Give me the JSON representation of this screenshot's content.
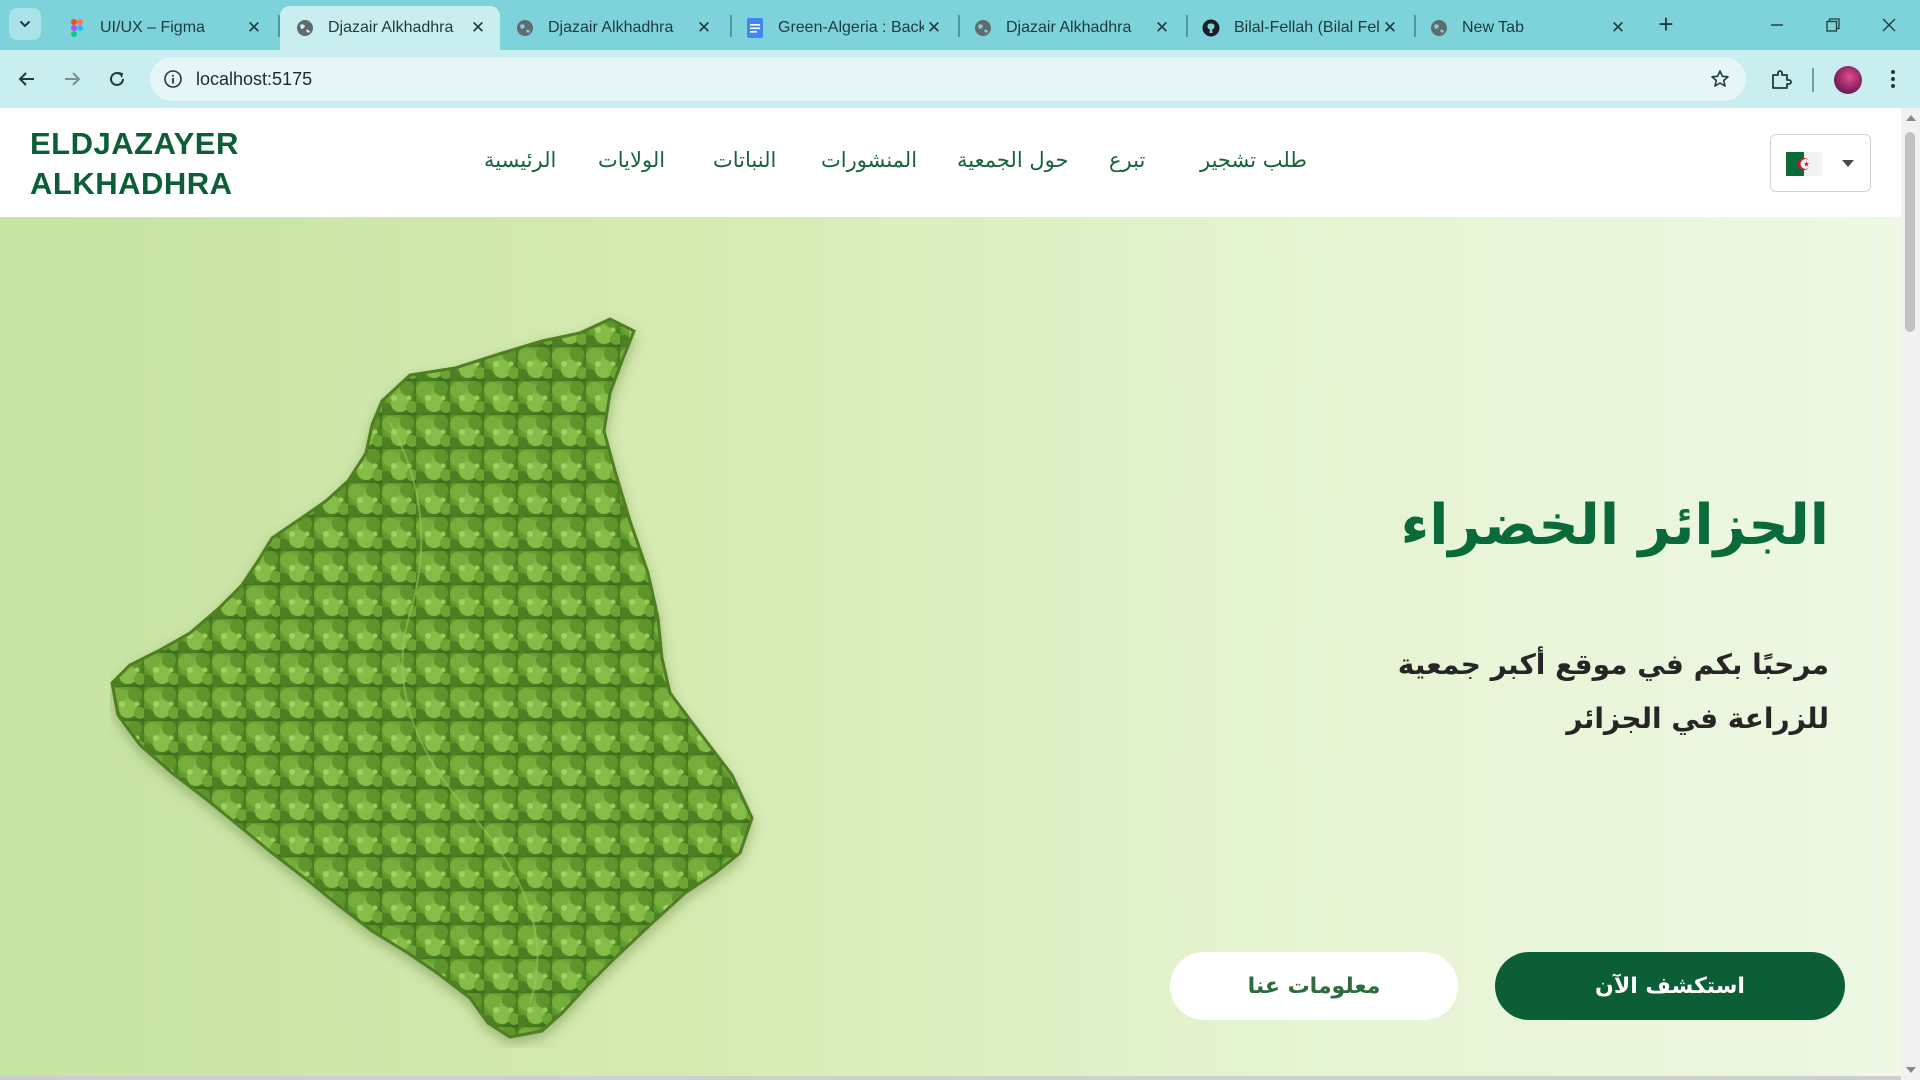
{
  "browser": {
    "tabs": [
      {
        "title": "UI/UX – Figma",
        "favicon": "figma-icon",
        "active": false
      },
      {
        "title": "Djazair Alkhadhra",
        "favicon": "globe-icon",
        "active": true
      },
      {
        "title": "Djazair Alkhadhra",
        "favicon": "globe-icon",
        "active": false
      },
      {
        "title": "Green-Algeria : Back",
        "favicon": "google-docs-icon",
        "active": false
      },
      {
        "title": "Djazair Alkhadhra",
        "favicon": "globe-icon",
        "active": false
      },
      {
        "title": "Bilal-Fellah (Bilal Fell",
        "favicon": "github-icon",
        "active": false
      },
      {
        "title": "New Tab",
        "favicon": "globe-icon",
        "active": false
      }
    ],
    "url": "localhost:5175",
    "colors": {
      "tab_strip": "#7ed3da",
      "toolbar": "#c9eef0"
    }
  },
  "site": {
    "logo_line1": "ELDJAZAYER",
    "logo_line2": "ALKHADHRA",
    "nav": {
      "tree_request": "طلب تشجير",
      "donate": "تبرع",
      "about": "حول الجمعية",
      "posts": "المنشورات",
      "plants": "النباتات",
      "states": "الولايات",
      "home": "الرئيسية"
    },
    "language_flag": "algeria-flag-icon",
    "colors": {
      "brand_green": "#0b5e36",
      "nav_text": "#17633c"
    }
  },
  "hero": {
    "title": "الجزائر الخضراء",
    "subtitle": "مرحبًا بكم في موقع أكبر جمعية للزراعة في الجزائر",
    "primary_button": "استكشف الآن",
    "secondary_button": "معلومات عنا",
    "image": "algeria-map-forest-illustration"
  }
}
